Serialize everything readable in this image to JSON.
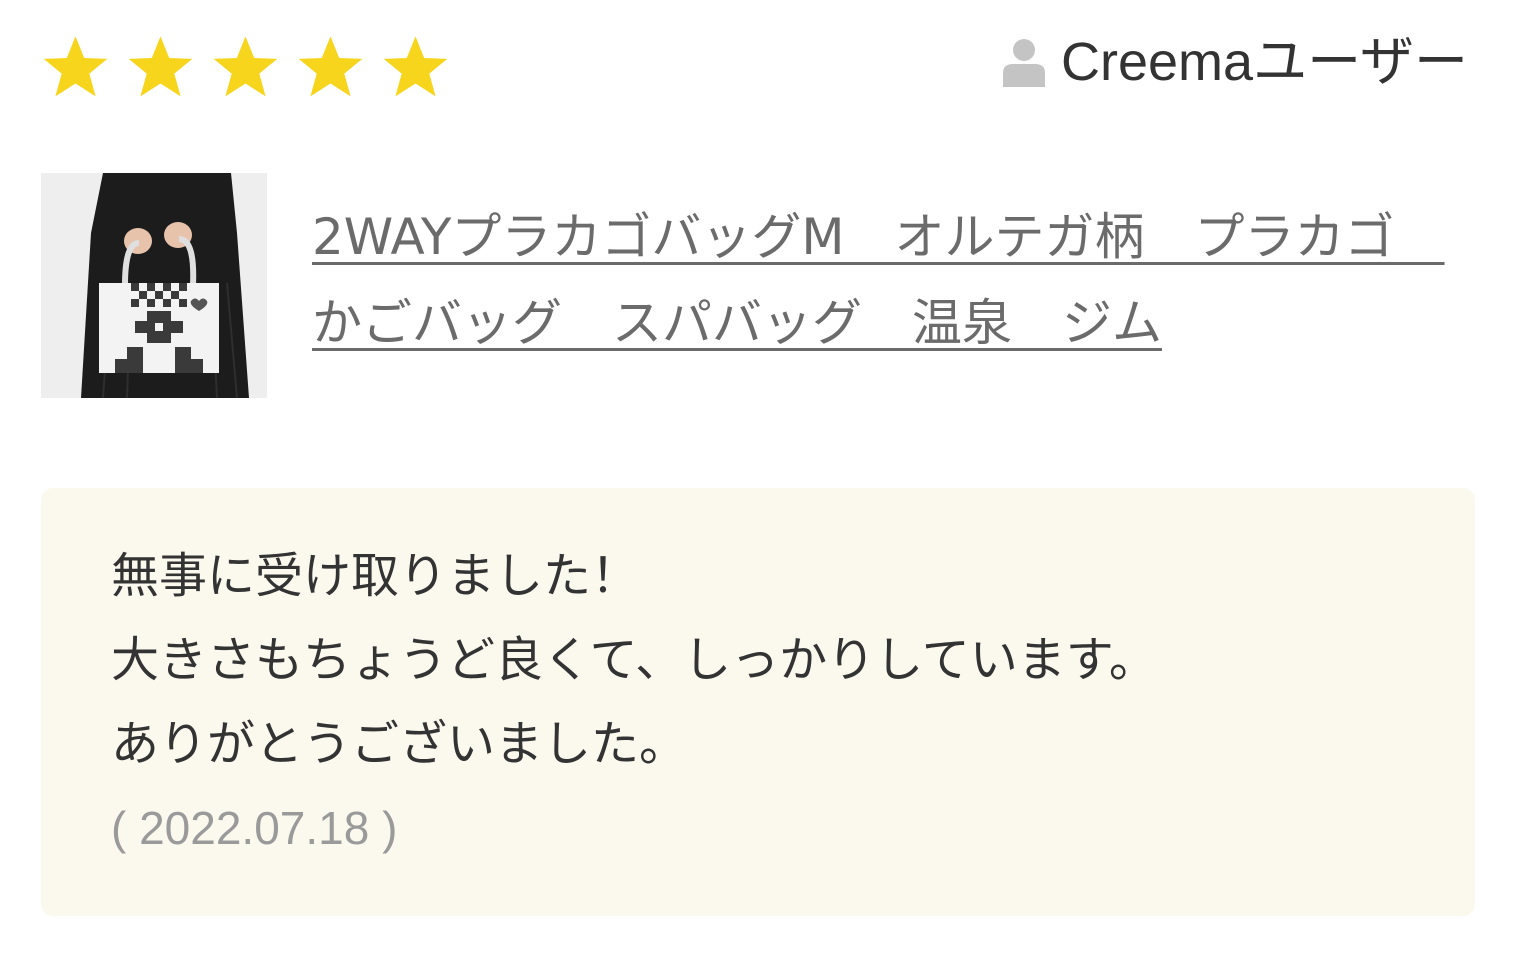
{
  "review": {
    "rating": 5,
    "rating_max": 5,
    "star_color": "#f7d51d",
    "user": {
      "name": "Creemaユーザー",
      "icon": "user-icon"
    },
    "product": {
      "title": "2WAYプラカゴバッグM　オルテガ柄　プラカゴ　かごバッグ　スパバッグ　温泉　ジム",
      "thumbnail_icon": "product-thumbnail"
    },
    "comment": {
      "lines": [
        "無事に受け取りました！",
        "大きさもちょうど良くて、しっかりしています。",
        "ありがとうございました。"
      ],
      "date": "( 2022.07.18 )"
    }
  }
}
